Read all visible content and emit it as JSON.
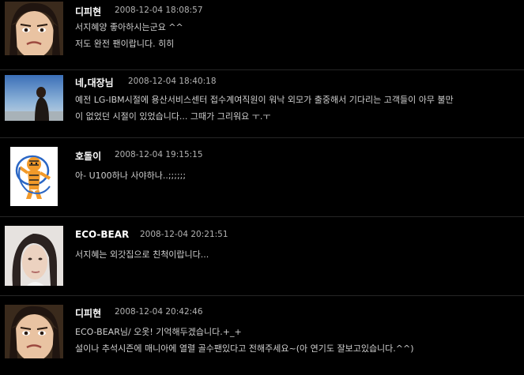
{
  "comments": [
    {
      "author": "디피현",
      "timestamp": "2008-12-04 18:08:57",
      "avatar": "girl-frown-photo",
      "lines": [
        "서지혜양 좋아하시는군요 ^^",
        "저도 완전 팬이랍니다. 히히"
      ]
    },
    {
      "author": "네,대장님",
      "timestamp": "2008-12-04 18:40:18",
      "avatar": "beach-sky-photo",
      "lines": [
        "예전 LG-IBM시절에 용산서비스센터 접수계여직원이 워낙 외모가 출중해서 기다리는 고객들이 아무 불만",
        "이 없었던 시절이 있었습니다... 그때가 그리워요 ㅜ.ㅜ"
      ]
    },
    {
      "author": "호돌이",
      "timestamp": "2008-12-04 19:15:15",
      "avatar": "tiger-mascot-icon",
      "lines": [
        "아- U100하나 사야하나..;;;;;;"
      ]
    },
    {
      "author": "ECO-BEAR",
      "timestamp": "2008-12-04 20:21:51",
      "avatar": "woman-portrait-photo",
      "lines": [
        "서지혜는 외갓집으로 친척이랍니다..."
      ]
    },
    {
      "author": "디피현",
      "timestamp": "2008-12-04 20:42:46",
      "avatar": "girl-frown-photo",
      "lines": [
        "ECO-BEAR님/ 오옷! 기억해두겠습니다.+_+",
        "설이나 추석시즌에 매니아에 열렬 골수팬있다고 전해주세요~(아 연기도 잘보고있습니다.^^)"
      ]
    }
  ]
}
